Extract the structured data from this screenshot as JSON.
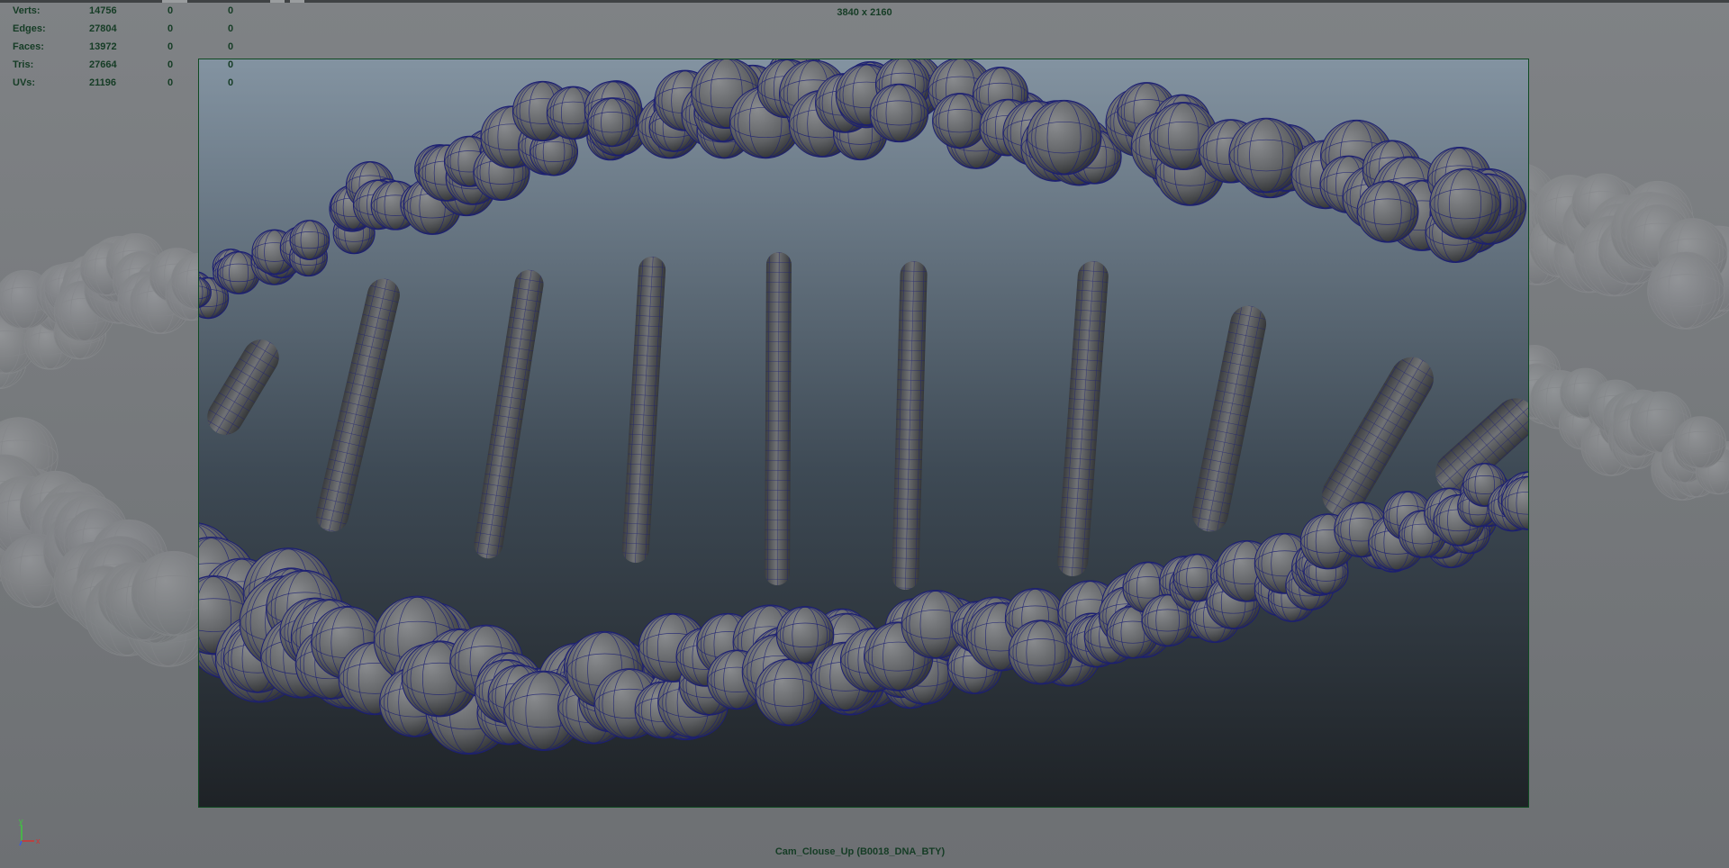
{
  "hud": {
    "rows": [
      {
        "label": "Verts:",
        "v1": "14756",
        "v2": "0",
        "v3": "0"
      },
      {
        "label": "Edges:",
        "v1": "27804",
        "v2": "0",
        "v3": "0"
      },
      {
        "label": "Faces:",
        "v1": "13972",
        "v2": "0",
        "v3": "0"
      },
      {
        "label": "Tris:",
        "v1": "27664",
        "v2": "0",
        "v3": "0"
      },
      {
        "label": "UVs:",
        "v1": "21196",
        "v2": "0",
        "v3": "0"
      }
    ]
  },
  "viewport": {
    "resolution_label": "3840 x 2160",
    "camera_label": "Cam_Clouse_Up (B0018_DNA_BTY)"
  },
  "axis_gizmo": {
    "y": "y",
    "x": "x"
  },
  "colors": {
    "hud_text": "#153c25",
    "gate_border": "#0f4a22",
    "wireframe": "#1c1f73",
    "sphere": "#6b6d70",
    "axis_x": "#d23232",
    "axis_y": "#3ec83e",
    "axis_z": "#3c5ae0"
  }
}
